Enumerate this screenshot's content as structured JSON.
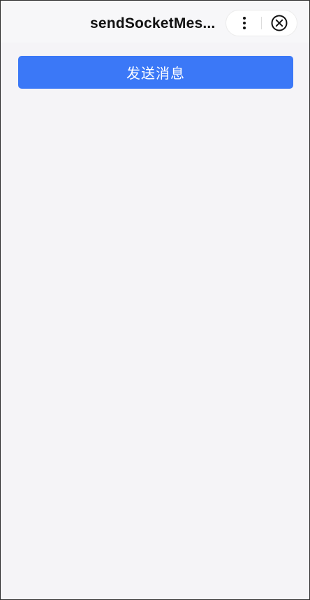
{
  "navbar": {
    "title": "sendSocketMes...",
    "more_icon": "more-dots-icon",
    "close_icon": "close-circle-icon"
  },
  "main": {
    "send_button_label": "发送消息"
  },
  "colors": {
    "primary": "#3b78f7",
    "background": "#f5f4f7",
    "navbar_background": "#f7f7f9"
  }
}
